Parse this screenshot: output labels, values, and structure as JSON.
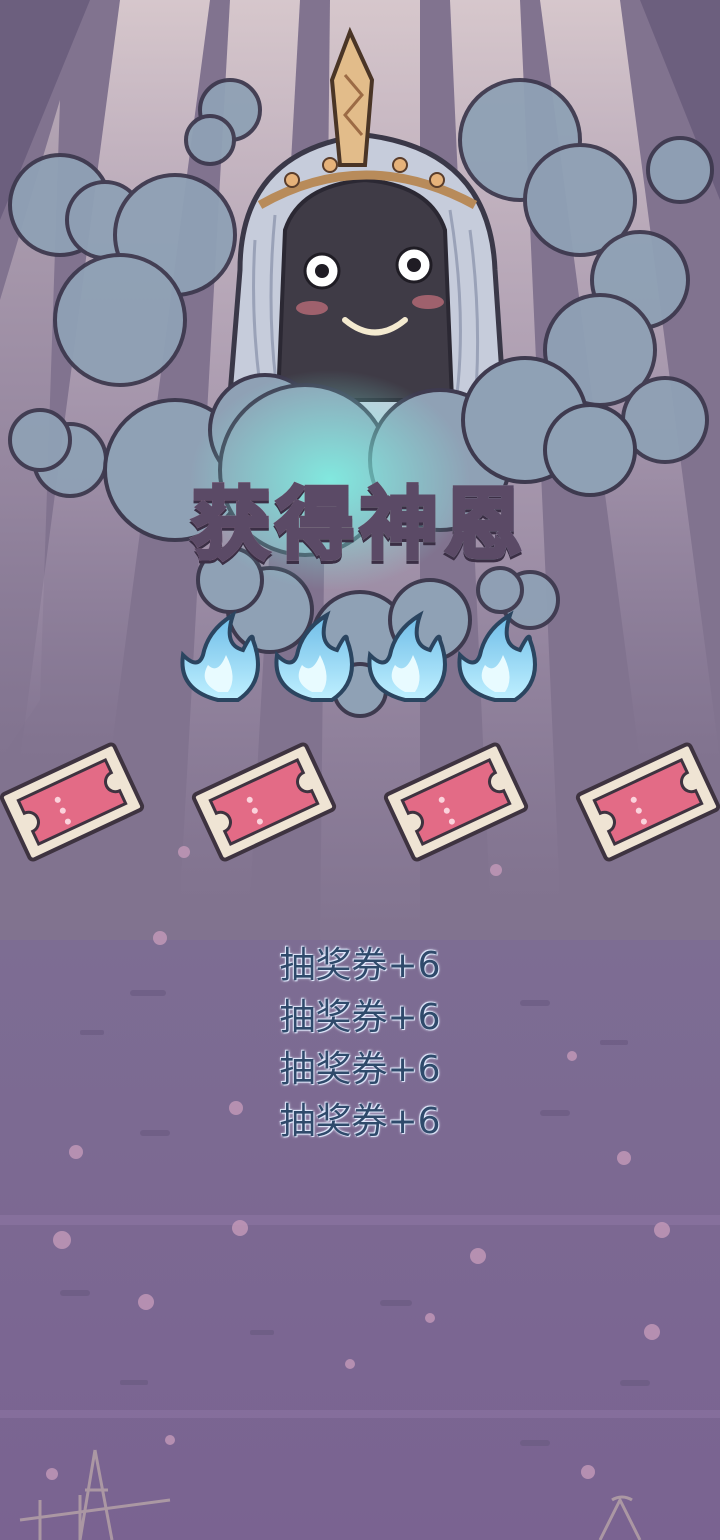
{
  "screen": {
    "title": "获得神恩",
    "rewards": [
      "抽奖券+6",
      "抽奖券+6",
      "抽奖券+6",
      "抽奖券+6"
    ]
  },
  "icons": {
    "character": "cloaked-deity-character",
    "flame": "blue-spirit-flame-icon",
    "ticket": "lottery-ticket-icon"
  },
  "colors": {
    "ticket": "#e36b86",
    "flame": "#8fd4f2",
    "cloud": "#8fa1b5"
  }
}
